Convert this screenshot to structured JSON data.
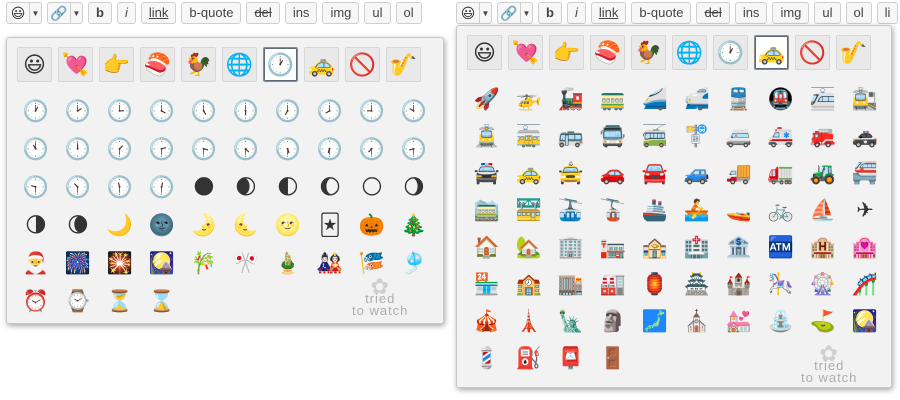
{
  "toolbar": {
    "emoji_icon": "😃",
    "link_icon": "🔗",
    "dropdown_caret": "▼",
    "buttons": [
      "b",
      "i",
      "link",
      "b-quote",
      "del",
      "ins",
      "img",
      "ul",
      "ol",
      "li"
    ]
  },
  "categories": [
    "😃",
    "💘",
    "👉",
    "🍣",
    "🐓",
    "🌐",
    "🕐",
    "🚕",
    "🚫",
    "🎷"
  ],
  "panel_left": {
    "active_category_index": 6,
    "emojis": [
      "🕐",
      "🕑",
      "🕒",
      "🕓",
      "🕔",
      "🕕",
      "🕖",
      "🕗",
      "🕘",
      "🕙",
      "🕚",
      "🕛",
      "🕜",
      "🕝",
      "🕞",
      "🕟",
      "🕠",
      "🕡",
      "🕢",
      "🕣",
      "🕤",
      "🕥",
      "🕦",
      "🕧",
      "🌑",
      "🌒",
      "🌓",
      "🌔",
      "🌕",
      "🌖",
      "🌗",
      "🌘",
      "🌙",
      "🌚",
      "🌛",
      "🌜",
      "🌝",
      "🃏",
      "🎃",
      "🎄",
      "🎅",
      "🎆",
      "🎇",
      "🎑",
      "🎋",
      "🎌",
      "🎍",
      "🎎",
      "🎏",
      "🎐",
      "⏰",
      "⌚",
      "⏳",
      "⌛"
    ],
    "watermark": [
      "tried",
      "to watch"
    ]
  },
  "panel_right": {
    "active_category_index": 7,
    "emojis": [
      "🚀",
      "🚁",
      "🚂",
      "🚃",
      "🚄",
      "🚅",
      "🚆",
      "🚇",
      "🚈",
      "🚉",
      "🚊",
      "🚋",
      "🚌",
      "🚍",
      "🚎",
      "🚏",
      "🚐",
      "🚑",
      "🚒",
      "🚓",
      "🚔",
      "🚕",
      "🚖",
      "🚗",
      "🚘",
      "🚙",
      "🚚",
      "🚛",
      "🚜",
      "🚝",
      "🚞",
      "🚟",
      "🚠",
      "🚡",
      "🚢",
      "🚣",
      "🚤",
      "🚲",
      "⛵",
      "✈",
      "🏠",
      "🏡",
      "🏢",
      "🏣",
      "🏤",
      "🏥",
      "🏦",
      "🏧",
      "🏨",
      "🏩",
      "🏪",
      "🏫",
      "🏬",
      "🏭",
      "🏮",
      "🏯",
      "🏰",
      "🎠",
      "🎡",
      "🎢",
      "🎪",
      "🗼",
      "🗽",
      "🗿",
      "🗾",
      "⛪",
      "💒",
      "⛲",
      "⛳",
      "🎑",
      "💈",
      "⛽",
      "📮",
      "🚪"
    ],
    "watermark": [
      "tried",
      "to watch"
    ]
  }
}
